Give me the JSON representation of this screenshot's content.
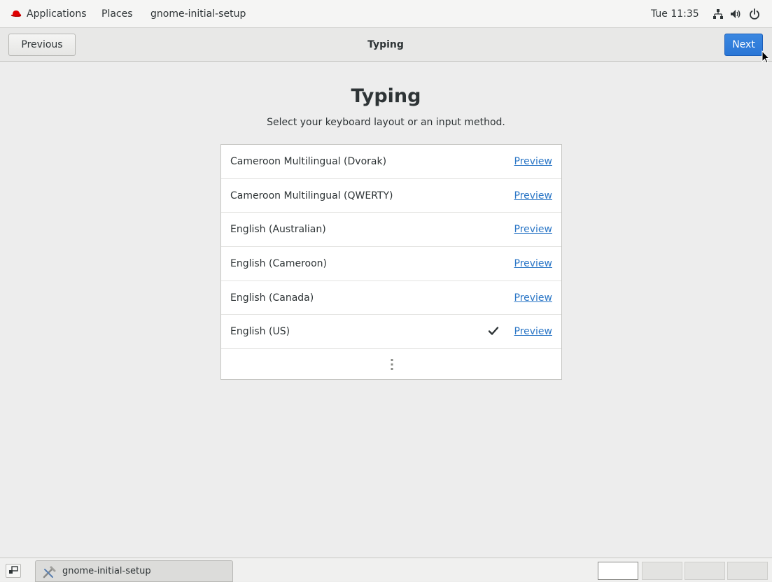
{
  "top_panel": {
    "applications_label": "Applications",
    "places_label": "Places",
    "app_name": "gnome-initial-setup",
    "clock": "Tue 11:35",
    "tray_icons": [
      "network-icon",
      "volume-icon",
      "power-icon"
    ]
  },
  "header": {
    "previous_label": "Previous",
    "title": "Typing",
    "next_label": "Next"
  },
  "main": {
    "heading": "Typing",
    "subtitle": "Select your keyboard layout or an input method.",
    "layouts": [
      {
        "label": "Cameroon Multilingual (Dvorak)",
        "preview": "Preview",
        "selected": false
      },
      {
        "label": "Cameroon Multilingual (QWERTY)",
        "preview": "Preview",
        "selected": false
      },
      {
        "label": "English (Australian)",
        "preview": "Preview",
        "selected": false
      },
      {
        "label": "English (Cameroon)",
        "preview": "Preview",
        "selected": false
      },
      {
        "label": "English (Canada)",
        "preview": "Preview",
        "selected": false
      },
      {
        "label": "English (US)",
        "preview": "Preview",
        "selected": true
      }
    ],
    "more_icon": "vertical-ellipsis-icon"
  },
  "bottom_panel": {
    "task_label": "gnome-initial-setup",
    "workspaces": [
      {
        "active": true
      },
      {
        "active": false
      },
      {
        "active": false
      },
      {
        "active": false
      }
    ]
  },
  "colors": {
    "accent": "#2a76d6",
    "link": "#2a76c6",
    "redhat_red": "#e00000"
  }
}
